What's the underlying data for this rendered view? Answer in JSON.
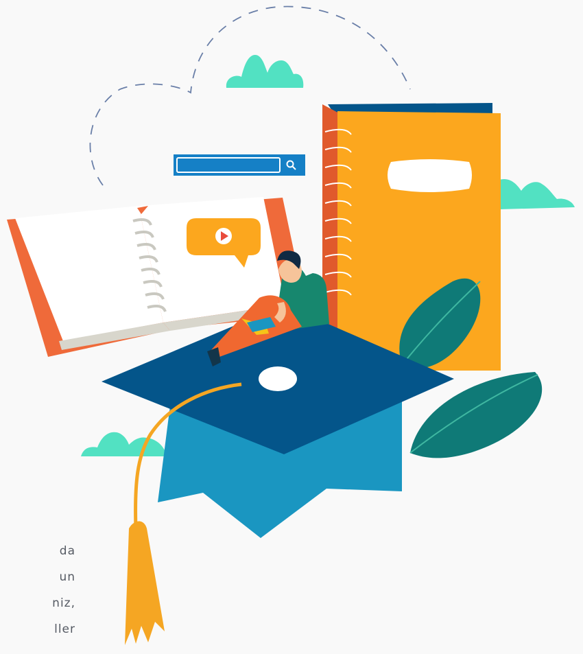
{
  "illustration": {
    "subject": "online-education-illustration",
    "colors": {
      "background": "#f9f9f9",
      "book_cover": "#ef6a3a",
      "notebook": "#fca71e",
      "notebook_back": "#e05a2c",
      "cap": "#04558a",
      "cap_band": "#1a96c1",
      "cloud": "#52e1c2",
      "leaf": "#0f7a77",
      "tassel": "#f5a623",
      "search_bar": "#1580c6",
      "person_pants": "#f06830",
      "person_shirt": "#17876e"
    }
  },
  "text_fragments": [
    "da",
    "un",
    "niz,",
    "ller"
  ]
}
